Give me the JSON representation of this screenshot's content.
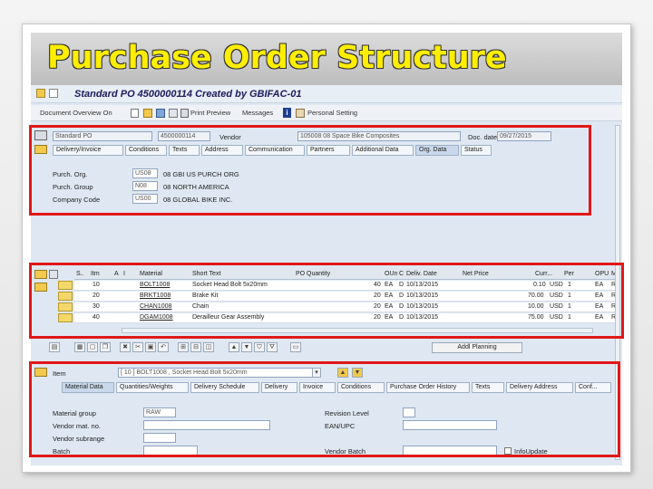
{
  "slide": {
    "title": "Purchase Order Structure"
  },
  "window": {
    "title": "Standard PO 4500000114 Created by GBIFAC-01"
  },
  "toolbar": {
    "items": [
      "Document Overview On",
      "Print Preview",
      "Messages",
      "Personal Setting"
    ]
  },
  "header": {
    "doc_type": "Standard PO",
    "po_number": "4500000114",
    "vendor_label": "Vendor",
    "vendor_value": "105008 08 Space Bike Composites",
    "doc_date_label": "Doc. date",
    "doc_date_value": "09/27/2015",
    "tabs": [
      "Delivery/Invoice",
      "Conditions",
      "Texts",
      "Address",
      "Communication",
      "Partners",
      "Additional Data",
      "Org. Data",
      "Status"
    ],
    "active_tab": "Org. Data",
    "org": [
      {
        "label": "Purch. Org.",
        "code": "US08",
        "desc": "08 GBI US PURCH ORG"
      },
      {
        "label": "Purch. Group",
        "code": "N08",
        "desc": "08 NORTH AMERICA"
      },
      {
        "label": "Company Code",
        "code": "US00",
        "desc": "08 GLOBAL BIKE INC."
      }
    ]
  },
  "items": {
    "columns": [
      "S..",
      "Itm",
      "A",
      "I",
      "Material",
      "Short Text",
      "PO Quantity",
      "OUn",
      "C",
      "Deliv. Date",
      "Net Price",
      "Curr...",
      "Per",
      "OPU",
      "M"
    ],
    "rows": [
      {
        "itm": "10",
        "material": "BOLT1008",
        "text": "Socket Head Bolt 5x20mm",
        "qty": "40",
        "oun": "EA",
        "c": "D",
        "date": "10/13/2015",
        "price": "0.10",
        "curr": "USD",
        "per": "1",
        "opu": "EA",
        "m": "R"
      },
      {
        "itm": "20",
        "material": "BRKT1008",
        "text": "Brake Kit",
        "qty": "20",
        "oun": "EA",
        "c": "D",
        "date": "10/13/2015",
        "price": "70.00",
        "curr": "USD",
        "per": "1",
        "opu": "EA",
        "m": "R"
      },
      {
        "itm": "30",
        "material": "CHAN1008",
        "text": "Chain",
        "qty": "20",
        "oun": "EA",
        "c": "D",
        "date": "10/13/2015",
        "price": "10.00",
        "curr": "USD",
        "per": "1",
        "opu": "EA",
        "m": "R"
      },
      {
        "itm": "40",
        "material": "DGAM1008",
        "text": "Derailleur Gear Assembly",
        "qty": "20",
        "oun": "EA",
        "c": "D",
        "date": "10/13/2015",
        "price": "75.00",
        "curr": "USD",
        "per": "1",
        "opu": "EA",
        "m": "R"
      }
    ],
    "addl_planning": "Addl Planning"
  },
  "item_detail": {
    "item_label": "Item",
    "item_value": "[ 10 ] BOLT1008 , Socket Head Bolt 5x20mm",
    "tabs": [
      "Material Data",
      "Quantities/Weights",
      "Delivery Schedule",
      "Delivery",
      "Invoice",
      "Conditions",
      "Purchase Order History",
      "Texts",
      "Delivery Address",
      "Conf..."
    ],
    "fields": {
      "material_group_label": "Material group",
      "material_group_value": "RAW",
      "vendor_mat_label": "Vendor mat. no.",
      "vendor_subrange_label": "Vendor subrange",
      "batch_label": "Batch",
      "revision_label": "Revision Level",
      "ean_label": "EAN/UPC",
      "vendor_batch_label": "Vendor Batch",
      "info_update_label": "InfoUpdate"
    }
  },
  "colors": {
    "highlight_border": "#e01818",
    "title_text": "#ffee00",
    "sap_background": "#dfe8f2"
  }
}
